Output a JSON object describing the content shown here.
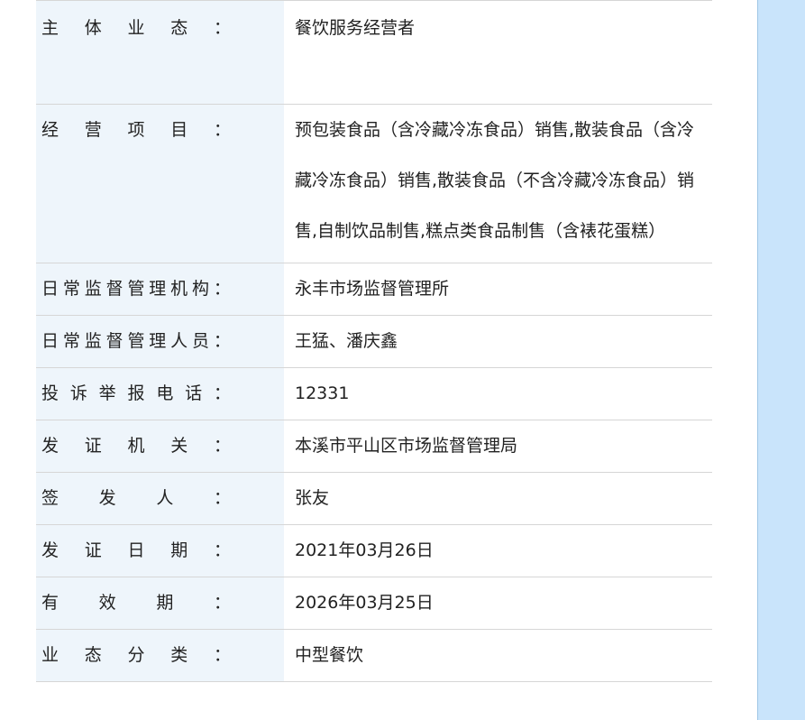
{
  "rows": [
    {
      "label": "主体业态：",
      "value": "餐饮服务经营者"
    },
    {
      "label": "经营项目：",
      "value": "预包装食品（含冷藏冷冻食品）销售,散装食品（含冷藏冷冻食品）销售,散装食品（不含冷藏冷冻食品）销售,自制饮品制售,糕点类食品制售（含裱花蛋糕）"
    },
    {
      "label": "日常监督管理机构：",
      "value": "永丰市场监督管理所"
    },
    {
      "label": "日常监督管理人员：",
      "value": "王猛、潘庆鑫"
    },
    {
      "label": "投诉举报电话：",
      "value": "12331"
    },
    {
      "label": "发证机关：",
      "value": "本溪市平山区市场监督管理局"
    },
    {
      "label": "签发人：",
      "value": "张友"
    },
    {
      "label": "发证日期：",
      "value": "2021年03月26日"
    },
    {
      "label": "有效期：",
      "value": "2026年03月25日"
    },
    {
      "label": "业态分类：",
      "value": "中型餐饮"
    }
  ]
}
